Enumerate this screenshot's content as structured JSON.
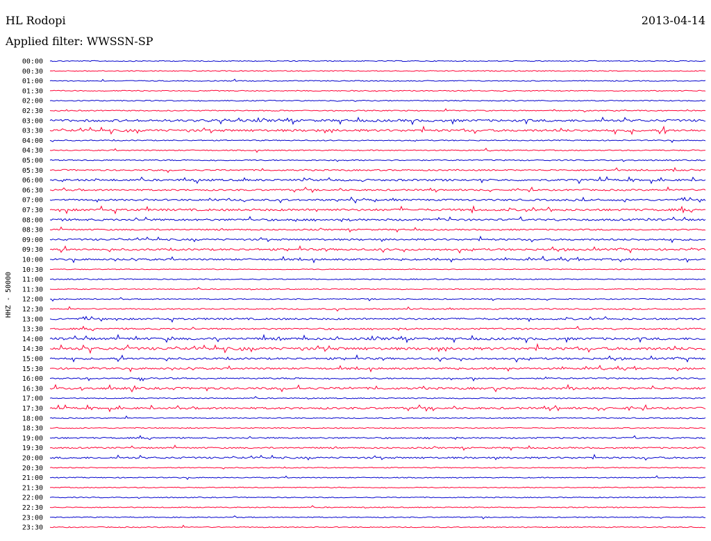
{
  "header": {
    "station": "HL Rodopi",
    "filter_label": "Applied filter: WWSSN-SP",
    "date": "2013-04-14"
  },
  "chart_data": {
    "type": "line",
    "title": "HL Rodopi",
    "subtitle": "Applied filter: WWSSN-SP",
    "date": "2013-04-14",
    "ylabel": "HHZ - 50000",
    "grid": false,
    "colors": [
      "#0000cc",
      "#ff0033"
    ],
    "rows": [
      {
        "time": "00:00",
        "activity": 0.05
      },
      {
        "time": "00:30",
        "activity": 0.05
      },
      {
        "time": "01:00",
        "activity": 0.05
      },
      {
        "time": "01:30",
        "activity": 0.05
      },
      {
        "time": "02:00",
        "activity": 0.1
      },
      {
        "time": "02:30",
        "activity": 0.1
      },
      {
        "time": "03:00",
        "activity": 0.8
      },
      {
        "time": "03:30",
        "activity": 0.8
      },
      {
        "time": "04:00",
        "activity": 0.1
      },
      {
        "time": "04:30",
        "activity": 0.1
      },
      {
        "time": "05:00",
        "activity": 0.2
      },
      {
        "time": "05:30",
        "activity": 0.3
      },
      {
        "time": "06:00",
        "activity": 0.6
      },
      {
        "time": "06:30",
        "activity": 0.4
      },
      {
        "time": "07:00",
        "activity": 0.5
      },
      {
        "time": "07:30",
        "activity": 0.7
      },
      {
        "time": "08:00",
        "activity": 0.6
      },
      {
        "time": "08:30",
        "activity": 0.3
      },
      {
        "time": "09:00",
        "activity": 0.5
      },
      {
        "time": "09:30",
        "activity": 0.6
      },
      {
        "time": "10:00",
        "activity": 0.5
      },
      {
        "time": "10:30",
        "activity": 0.0
      },
      {
        "time": "11:00",
        "activity": 0.1
      },
      {
        "time": "11:30",
        "activity": 0.1
      },
      {
        "time": "12:00",
        "activity": 0.1
      },
      {
        "time": "12:30",
        "activity": 0.2
      },
      {
        "time": "13:00",
        "activity": 0.5
      },
      {
        "time": "13:30",
        "activity": 0.4
      },
      {
        "time": "14:00",
        "activity": 0.8
      },
      {
        "time": "14:30",
        "activity": 1.0
      },
      {
        "time": "15:00",
        "activity": 0.6
      },
      {
        "time": "15:30",
        "activity": 0.5
      },
      {
        "time": "16:00",
        "activity": 0.3
      },
      {
        "time": "16:30",
        "activity": 0.7
      },
      {
        "time": "17:00",
        "activity": 0.1
      },
      {
        "time": "17:30",
        "activity": 0.6
      },
      {
        "time": "18:00",
        "activity": 0.1
      },
      {
        "time": "18:30",
        "activity": 0.1
      },
      {
        "time": "19:00",
        "activity": 0.3
      },
      {
        "time": "19:30",
        "activity": 0.3
      },
      {
        "time": "20:00",
        "activity": 0.5
      },
      {
        "time": "20:30",
        "activity": 0.05
      },
      {
        "time": "21:00",
        "activity": 0.05
      },
      {
        "time": "21:30",
        "activity": 0.05
      },
      {
        "time": "22:00",
        "activity": 0.05
      },
      {
        "time": "22:30",
        "activity": 0.05
      },
      {
        "time": "23:00",
        "activity": 0.05
      },
      {
        "time": "23:30",
        "activity": 0.05
      }
    ]
  }
}
